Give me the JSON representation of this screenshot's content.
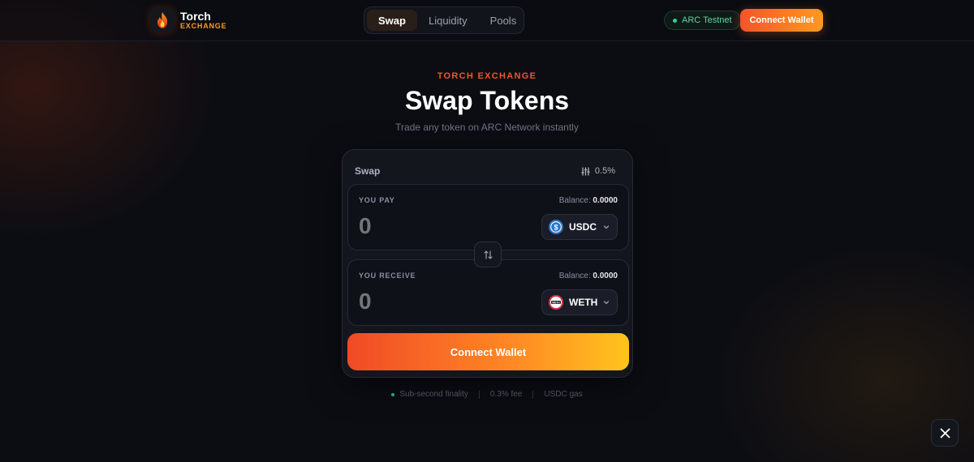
{
  "brand": {
    "name": "Torch",
    "sub": "EXCHANGE",
    "logo_icon": "flame-icon"
  },
  "nav": {
    "tabs": [
      {
        "label": "Swap",
        "active": true
      },
      {
        "label": "Liquidity"
      },
      {
        "label": "Pools"
      }
    ]
  },
  "header": {
    "network": "ARC Testnet",
    "connect_label": "Connect Wallet"
  },
  "hero": {
    "eyebrow": "TORCH EXCHANGE",
    "title": "Swap Tokens",
    "subtitle": "Trade any token on ARC Network instantly"
  },
  "card": {
    "label": "Swap",
    "slippage": "0.5%",
    "slippage_icon": "sliders-icon",
    "pay": {
      "label": "YOU PAY",
      "balance_label": "Balance:",
      "balance": "0.0000",
      "amount": "0",
      "token": "USDC",
      "token_icon": "usdc-icon"
    },
    "receive": {
      "label": "YOU RECEIVE",
      "balance_label": "Balance:",
      "balance": "0.0000",
      "amount": "0",
      "token": "WETH",
      "token_icon": "weth-icon"
    },
    "swap_direction_icon": "swap-arrows-icon",
    "connect_label": "Connect Wallet"
  },
  "footer": {
    "items": [
      "Sub-second finality",
      "0.3% fee",
      "USDC gas"
    ]
  },
  "social": {
    "icon": "x-icon"
  },
  "colors": {
    "accent": "#f2552a",
    "accent_end": "#ffc51c",
    "network": "#34d399",
    "background": "#0c0d13"
  }
}
